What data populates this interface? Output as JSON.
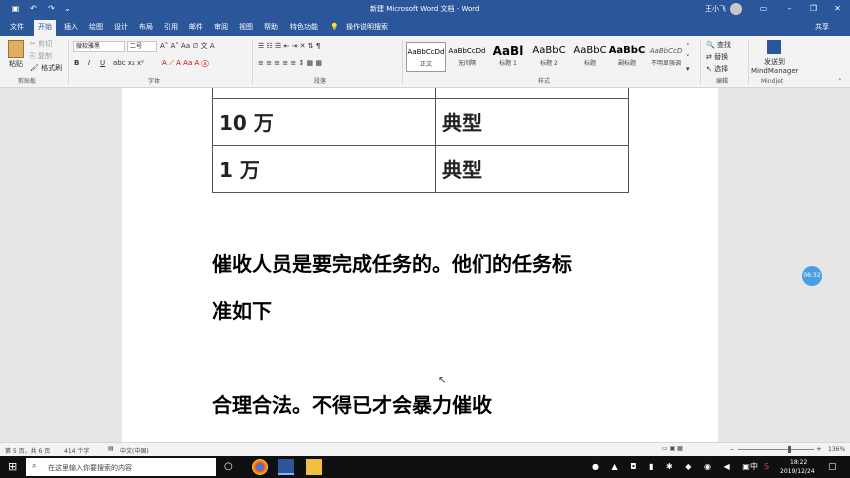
{
  "title_bar": {
    "title": "新建 Microsoft Word 文档 - Word",
    "user": "王小飞"
  },
  "tabs": [
    "文件",
    "开始",
    "插入",
    "绘图",
    "设计",
    "布局",
    "引用",
    "邮件",
    "审阅",
    "视图",
    "帮助",
    "特色功能"
  ],
  "tell_me": "操作说明搜索",
  "share": "共享",
  "ribbon": {
    "clipboard": {
      "paste": "粘贴",
      "cut": "剪切",
      "copy": "复制",
      "format_painter": "格式刷",
      "group": "剪贴板"
    },
    "font": {
      "family": "微软雅黑",
      "size": "二号",
      "group": "字体"
    },
    "paragraph": {
      "group": "段落"
    },
    "styles": {
      "items": [
        {
          "preview": "AaBbCcDd",
          "name": "正文"
        },
        {
          "preview": "AaBbCcDd",
          "name": "无间隔"
        },
        {
          "preview": "AaBl",
          "name": "标题 1"
        },
        {
          "preview": "AaBbC",
          "name": "标题 2"
        },
        {
          "preview": "AaBbC",
          "name": "标题"
        },
        {
          "preview": "AaBbC",
          "name": "副标题"
        },
        {
          "preview": "AaBbCcD",
          "name": "不明显强调"
        }
      ],
      "group": "样式"
    },
    "editing": {
      "find": "查找",
      "replace": "替换",
      "select": "选择",
      "group": "编辑"
    },
    "mindjet": {
      "send_to": "发送到",
      "product": "MindManager",
      "group": "Mindjet"
    }
  },
  "document": {
    "table_rows": [
      {
        "c1": "10 万",
        "c2": "典型"
      },
      {
        "c1": "1 万",
        "c2": "典型"
      }
    ],
    "line1": "催收人员是要完成任务的。他们的任务标",
    "line2": "准如下",
    "line3": "合理合法。不得已才会暴力催收",
    "timer_badge": "06:32"
  },
  "status": {
    "page": "第 5 页，共 6 页",
    "words": "414 个字",
    "lang": "中文(中国)",
    "zoom": "136%"
  },
  "taskbar": {
    "search_placeholder": "在这里输入你要搜索的内容",
    "time": "18:22",
    "date": "2019/12/24",
    "ime": "中"
  }
}
